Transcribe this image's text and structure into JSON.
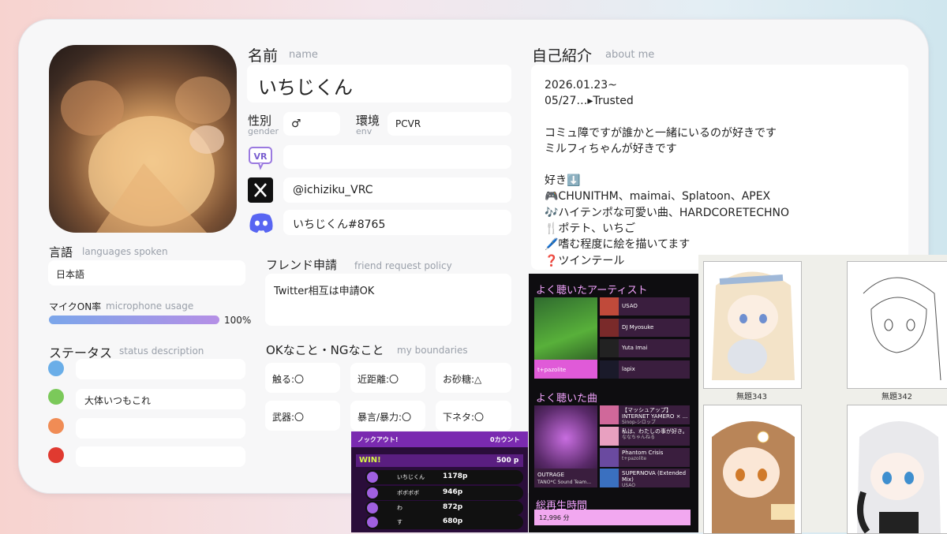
{
  "profile": {
    "name_label": "名前",
    "name_sub": "name",
    "name_value": "いちじくん",
    "gender_label": "性別",
    "gender_sub": "gender",
    "gender_value": "♂",
    "env_label": "環境",
    "env_sub": "env",
    "env_value": "PCVR",
    "vrchat_value": "",
    "x_value": "@ichiziku_VRC",
    "discord_value": "いちじくん#8765",
    "lang_label": "言語",
    "lang_sub": "languages spoken",
    "lang_value": "日本語",
    "mic_label": "マイクON率",
    "mic_sub": "microphone usage",
    "mic_percent": "100%",
    "mic_fraction": 1.0,
    "status_label": "ステータス",
    "status_sub": "status description",
    "status_items": [
      {
        "color": "#6aaee8",
        "text": ""
      },
      {
        "color": "#7bc95a",
        "text": "大体いつもこれ"
      },
      {
        "color": "#f08c55",
        "text": ""
      },
      {
        "color": "#e03a30",
        "text": ""
      }
    ],
    "friend_label": "フレンド申請",
    "friend_sub": "friend request policy",
    "friend_value": "Twitter相互は申請OK",
    "boundaries_label": "OKなこと・NGなこと",
    "boundaries_sub": "my boundaries",
    "boundaries": [
      "触る:〇",
      "近距離:〇",
      "お砂糖:△",
      "武器:〇",
      "暴言/暴力:〇",
      "下ネタ:〇"
    ],
    "about_label": "自己紹介",
    "about_sub": "about me",
    "about_lines": [
      "2026.01.23~",
      "05/27…▸Trusted",
      "",
      "コミュ障ですが誰かと一緒にいるのが好きです",
      "ミルフィちゃんが好きです",
      "",
      "好き⬇️",
      "🎮CHUNITHM、maimai、Splatoon、APEX",
      "🎶ハイテンポな可愛い曲、HARDCORETECHNO",
      "🍴ポテト、いちご",
      "🖊️嗜む程度に絵を描いてます",
      "❓ツインテール"
    ]
  },
  "music": {
    "artists_title": "よく聴いたアーティスト",
    "top_artist": "t+pazolite",
    "artists": [
      "USAO",
      "DJ Myosuke",
      "Yuta Imai",
      "lapix"
    ],
    "songs_title": "よく聴いた曲",
    "top_song": "OUTRAGE",
    "top_song_sub": "TANO*C Sound Team...",
    "songs": [
      {
        "title": "【マッシュアップ】INTERNET YAMERO × ...",
        "artist": "Sinop-シロップ"
      },
      {
        "title": "私は、わたしの事が好き。",
        "artist": "ななちゃんねる"
      },
      {
        "title": "Phantom Crisis",
        "artist": "t+pazolite"
      },
      {
        "title": "SUPERNOVA (Extended Mix)",
        "artist": "USAO"
      }
    ],
    "total_title": "総再生時間",
    "total_value": "12,996 分"
  },
  "splatoon": {
    "header_left": "ノックアウト!",
    "header_right": "0カウント",
    "result": "WIN!",
    "points": "500 p",
    "players": [
      {
        "name": "いちじくん",
        "score": "1178p"
      },
      {
        "name": "ボボボボ",
        "score": "946p"
      },
      {
        "name": "わ",
        "score": "872p"
      },
      {
        "name": "す",
        "score": "680p"
      }
    ]
  },
  "drawings": {
    "captions": [
      "無題343",
      "無題342"
    ]
  }
}
